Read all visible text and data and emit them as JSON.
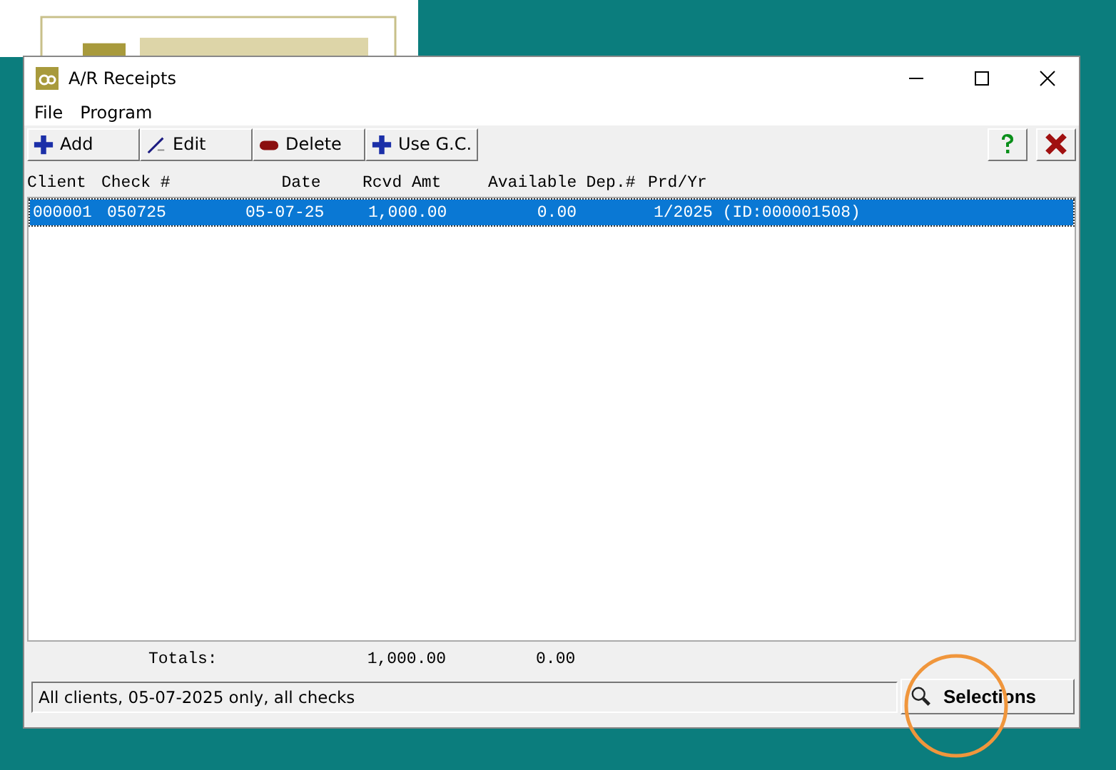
{
  "window": {
    "title": "A/R Receipts"
  },
  "menu": [
    "File",
    "Program"
  ],
  "toolbar": [
    "Add",
    "Edit",
    "Delete",
    "Use G.C."
  ],
  "table": {
    "columns": [
      "Client",
      "Check #",
      "Date",
      "Rcvd Amt",
      "Available",
      "Dep.#",
      "Prd/Yr"
    ],
    "rows": [
      {
        "cells": [
          "000001",
          "050725",
          "05-07-25",
          "1,000.00",
          "0.00",
          "",
          "1/2025 (ID:000001508)"
        ],
        "selected": true
      }
    ]
  },
  "totals": {
    "label": "Totals:",
    "rcvd_amt": "1,000.00",
    "available": "0.00"
  },
  "status": "All clients, 05-07-2025 only, all checks",
  "selections_button": "Selections"
}
